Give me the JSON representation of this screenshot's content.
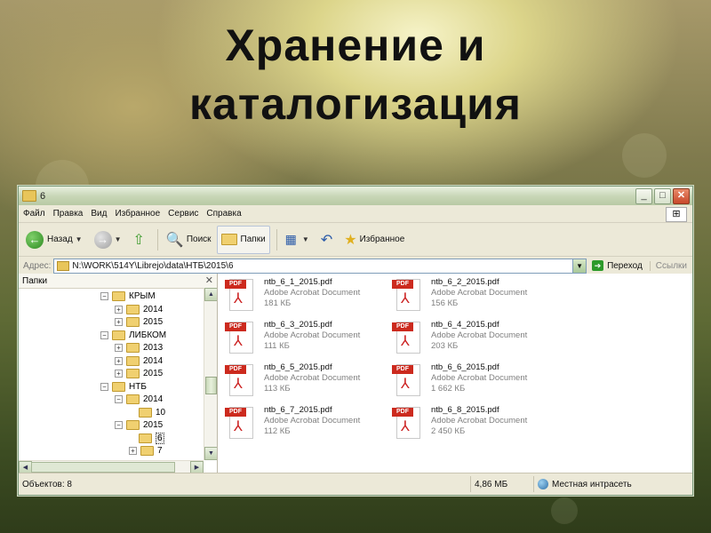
{
  "slide": {
    "title_line1": "Хранение и",
    "title_line2": "каталогизация"
  },
  "window": {
    "title": "6"
  },
  "menu": [
    "Файл",
    "Правка",
    "Вид",
    "Избранное",
    "Сервис",
    "Справка"
  ],
  "toolbar": {
    "back": "Назад",
    "search": "Поиск",
    "folders": "Папки",
    "favorites": "Избранное"
  },
  "address": {
    "label": "Адрес:",
    "path": "N:\\WORK\\514Y\\Librejo\\data\\НТБ\\2015\\6",
    "go": "Переход",
    "links": "Ссылки"
  },
  "folders_pane": {
    "title": "Папки",
    "tree": [
      {
        "label": "КРЫМ",
        "sign": "⊟"
      },
      {
        "label": "2014",
        "sign": "⊞"
      },
      {
        "label": "2015",
        "sign": "⊞"
      },
      {
        "label": "ЛИБКОМ",
        "sign": "⊟"
      },
      {
        "label": "2013",
        "sign": "⊞"
      },
      {
        "label": "2014",
        "sign": "⊞"
      },
      {
        "label": "2015",
        "sign": "⊞"
      },
      {
        "label": "НТБ",
        "sign": "⊟"
      },
      {
        "label": "2014",
        "sign": "⊟"
      },
      {
        "label": "10",
        "sign": ""
      },
      {
        "label": "2015",
        "sign": "⊟"
      },
      {
        "label": "6",
        "sign": ""
      },
      {
        "label": "7",
        "sign": "⊞"
      }
    ]
  },
  "files": [
    {
      "name": "ntb_6_1_2015.pdf",
      "type": "Adobe Acrobat Document",
      "size": "181 КБ"
    },
    {
      "name": "ntb_6_2_2015.pdf",
      "type": "Adobe Acrobat Document",
      "size": "156 КБ"
    },
    {
      "name": "ntb_6_3_2015.pdf",
      "type": "Adobe Acrobat Document",
      "size": "111 КБ"
    },
    {
      "name": "ntb_6_4_2015.pdf",
      "type": "Adobe Acrobat Document",
      "size": "203 КБ"
    },
    {
      "name": "ntb_6_5_2015.pdf",
      "type": "Adobe Acrobat Document",
      "size": "113 КБ"
    },
    {
      "name": "ntb_6_6_2015.pdf",
      "type": "Adobe Acrobat Document",
      "size": "1 662 КБ"
    },
    {
      "name": "ntb_6_7_2015.pdf",
      "type": "Adobe Acrobat Document",
      "size": "112 КБ"
    },
    {
      "name": "ntb_6_8_2015.pdf",
      "type": "Adobe Acrobat Document",
      "size": "2 450 КБ"
    }
  ],
  "status": {
    "objects": "Объектов: 8",
    "size": "4,86 МБ",
    "zone": "Местная интрасеть"
  },
  "icons": [
    "folder-icon",
    "back-arrow-icon",
    "forward-arrow-icon",
    "up-folder-icon",
    "search-icon",
    "folders-icon",
    "views-icon",
    "undo-icon",
    "favorites-star-icon",
    "go-arrow-icon",
    "pdf-file-icon",
    "intranet-globe-icon"
  ],
  "colors": {
    "accent": "#2e8a22",
    "pdf_red": "#cc2a1e",
    "window_bg": "#ece9d8"
  }
}
